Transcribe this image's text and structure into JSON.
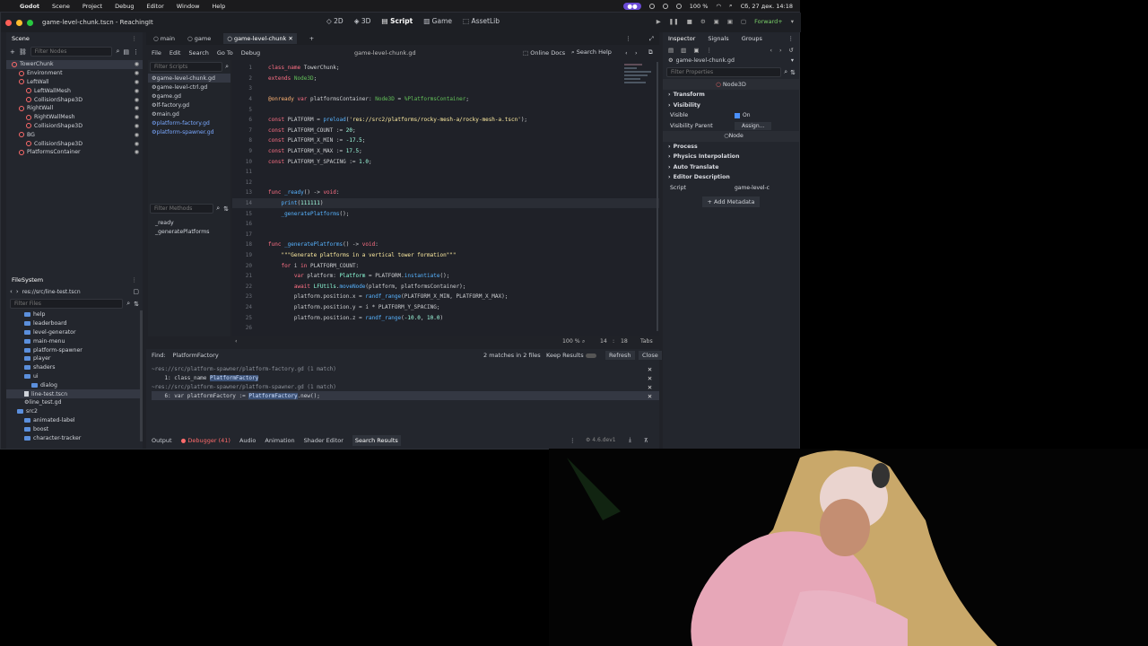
{
  "menubar": {
    "app": "Godot",
    "items": [
      "Scene",
      "Project",
      "Debug",
      "Editor",
      "Window",
      "Help"
    ],
    "battery": "100 %",
    "datetime": "Сб, 27 дек. 14:18"
  },
  "window": {
    "title": "game-level-chunk.tscn - ReachingIt",
    "workspaces": [
      "2D",
      "3D",
      "Script",
      "Game",
      "AssetLib"
    ],
    "active_workspace": "Script",
    "renderer": "Forward+"
  },
  "scene_dock": {
    "tabs": [
      "Scene",
      "Import"
    ],
    "filter_placeholder": "Filter Nodes",
    "nodes": [
      {
        "name": "TowerChunk",
        "depth": 0,
        "color": "#ff6b6b"
      },
      {
        "name": "Environment",
        "depth": 1,
        "color": "#ff6b6b"
      },
      {
        "name": "LeftWall",
        "depth": 1,
        "color": "#ff6b6b"
      },
      {
        "name": "LeftWallMesh",
        "depth": 2,
        "color": "#ff6b6b"
      },
      {
        "name": "CollisionShape3D",
        "depth": 2,
        "color": "#ff6b6b"
      },
      {
        "name": "RightWall",
        "depth": 1,
        "color": "#ff6b6b"
      },
      {
        "name": "RightWallMesh",
        "depth": 2,
        "color": "#ff6b6b"
      },
      {
        "name": "CollisionShape3D",
        "depth": 2,
        "color": "#ff6b6b"
      },
      {
        "name": "BG",
        "depth": 1,
        "color": "#ff6b6b"
      },
      {
        "name": "CollisionShape3D",
        "depth": 2,
        "color": "#ff6b6b"
      },
      {
        "name": "PlatformsContainer",
        "depth": 1,
        "color": "#ff6b6b"
      }
    ]
  },
  "filesystem": {
    "title": "FileSystem",
    "path": "res://src/line-test.tscn",
    "filter_placeholder": "Filter Files",
    "items": [
      {
        "name": "help",
        "depth": 2,
        "type": "folder"
      },
      {
        "name": "leaderboard",
        "depth": 2,
        "type": "folder"
      },
      {
        "name": "level-generator",
        "depth": 2,
        "type": "folder"
      },
      {
        "name": "main-menu",
        "depth": 2,
        "type": "folder"
      },
      {
        "name": "platform-spawner",
        "depth": 2,
        "type": "folder"
      },
      {
        "name": "player",
        "depth": 2,
        "type": "folder"
      },
      {
        "name": "shaders",
        "depth": 2,
        "type": "folder"
      },
      {
        "name": "ui",
        "depth": 2,
        "type": "folder"
      },
      {
        "name": "dialog",
        "depth": 3,
        "type": "folder"
      },
      {
        "name": "line-test.tscn",
        "depth": 2,
        "type": "scene",
        "selected": true
      },
      {
        "name": "line_test.gd",
        "depth": 2,
        "type": "script"
      },
      {
        "name": "src2",
        "depth": 1,
        "type": "folder"
      },
      {
        "name": "animated-label",
        "depth": 2,
        "type": "folder"
      },
      {
        "name": "boost",
        "depth": 2,
        "type": "folder"
      },
      {
        "name": "character-tracker",
        "depth": 2,
        "type": "folder"
      }
    ]
  },
  "editor_tabs": [
    "main",
    "game",
    "game-level-chunk"
  ],
  "active_tab": "game-level-chunk",
  "script_menu": [
    "File",
    "Edit",
    "Search",
    "Go To",
    "Debug"
  ],
  "current_file": "game-level-chunk.gd",
  "online_docs": "Online Docs",
  "search_help": "Search Help",
  "scripts_filter": "Filter Scripts",
  "scripts": [
    {
      "name": "game-level-chunk.gd",
      "selected": true,
      "blue": false
    },
    {
      "name": "game-level-ctrl.gd",
      "selected": false,
      "blue": false
    },
    {
      "name": "game.gd",
      "selected": false,
      "blue": false
    },
    {
      "name": "lf-factory.gd",
      "selected": false,
      "blue": false
    },
    {
      "name": "main.gd",
      "selected": false,
      "blue": false
    },
    {
      "name": "platform-factory.gd",
      "selected": false,
      "blue": true
    },
    {
      "name": "platform-spawner.gd",
      "selected": false,
      "blue": true
    }
  ],
  "methods_filter": "Filter Methods",
  "methods": [
    "_ready",
    "_generatePlatforms"
  ],
  "code": [
    {
      "n": "1",
      "parts": [
        [
          "kw",
          "class_name "
        ],
        [
          "tx",
          "TowerChunk;"
        ]
      ]
    },
    {
      "n": "2",
      "parts": [
        [
          "kw",
          "extends "
        ],
        [
          "node",
          "Node3D"
        ],
        [
          "tx",
          ";"
        ]
      ]
    },
    {
      "n": "3",
      "parts": []
    },
    {
      "n": "4",
      "parts": [
        [
          "ann",
          "@onready "
        ],
        [
          "kw",
          "var "
        ],
        [
          "tx",
          "platformsContainer: "
        ],
        [
          "node",
          "Node3D"
        ],
        [
          "tx",
          " = "
        ],
        [
          "node",
          "%PlatformsContainer"
        ],
        [
          "tx",
          ";"
        ]
      ]
    },
    {
      "n": "5",
      "parts": []
    },
    {
      "n": "6",
      "parts": [
        [
          "kw",
          "const "
        ],
        [
          "tx",
          "PLATFORM = "
        ],
        [
          "fn",
          "preload"
        ],
        [
          "tx",
          "("
        ],
        [
          "str",
          "'res://src2/platforms/rocky-mesh-a/rocky-mesh-a.tscn'"
        ],
        [
          "tx",
          ");"
        ]
      ]
    },
    {
      "n": "7",
      "parts": [
        [
          "kw",
          "const "
        ],
        [
          "tx",
          "PLATFORM_COUNT := "
        ],
        [
          "num",
          "20"
        ],
        [
          "tx",
          ";"
        ]
      ]
    },
    {
      "n": "8",
      "parts": [
        [
          "kw",
          "const "
        ],
        [
          "tx",
          "PLATFORM_X_MIN := "
        ],
        [
          "num",
          "-17.5"
        ],
        [
          "tx",
          ";"
        ]
      ]
    },
    {
      "n": "9",
      "parts": [
        [
          "kw",
          "const "
        ],
        [
          "tx",
          "PLATFORM_X_MAX := "
        ],
        [
          "num",
          "17.5"
        ],
        [
          "tx",
          ";"
        ]
      ]
    },
    {
      "n": "10",
      "parts": [
        [
          "kw",
          "const "
        ],
        [
          "tx",
          "PLATFORM_Y_SPACING := "
        ],
        [
          "num",
          "1.0"
        ],
        [
          "tx",
          ";"
        ]
      ]
    },
    {
      "n": "11",
      "parts": []
    },
    {
      "n": "12",
      "parts": []
    },
    {
      "n": "13",
      "parts": [
        [
          "kw",
          "func "
        ],
        [
          "fn",
          "_ready"
        ],
        [
          "tx",
          "() -> "
        ],
        [
          "kw",
          "void"
        ],
        [
          "tx",
          ":"
        ]
      ]
    },
    {
      "n": "14",
      "parts": [
        [
          "tx",
          "    "
        ],
        [
          "fn",
          "print"
        ],
        [
          "tx",
          "("
        ],
        [
          "num",
          "111111"
        ],
        [
          "tx",
          ")"
        ]
      ],
      "current": true
    },
    {
      "n": "15",
      "parts": [
        [
          "tx",
          "    "
        ],
        [
          "fn",
          "_generatePlatforms"
        ],
        [
          "tx",
          "();"
        ]
      ]
    },
    {
      "n": "16",
      "parts": []
    },
    {
      "n": "17",
      "parts": []
    },
    {
      "n": "18",
      "parts": [
        [
          "kw",
          "func "
        ],
        [
          "fn",
          "_generatePlatforms"
        ],
        [
          "tx",
          "() -> "
        ],
        [
          "kw",
          "void"
        ],
        [
          "tx",
          ":"
        ]
      ]
    },
    {
      "n": "19",
      "parts": [
        [
          "tx",
          "    "
        ],
        [
          "str",
          "\"\"\"Generate platforms in a vertical tower formation\"\"\""
        ]
      ]
    },
    {
      "n": "20",
      "parts": [
        [
          "tx",
          "    "
        ],
        [
          "kw",
          "for "
        ],
        [
          "tx",
          "i "
        ],
        [
          "kw",
          "in "
        ],
        [
          "tx",
          "PLATFORM_COUNT:"
        ]
      ]
    },
    {
      "n": "21",
      "parts": [
        [
          "tx",
          "        "
        ],
        [
          "kw",
          "var "
        ],
        [
          "tx",
          "platform: "
        ],
        [
          "ty",
          "Platform"
        ],
        [
          "tx",
          " = PLATFORM."
        ],
        [
          "fn",
          "instantiate"
        ],
        [
          "tx",
          "();"
        ]
      ]
    },
    {
      "n": "22",
      "parts": [
        [
          "tx",
          "        "
        ],
        [
          "kw",
          "await "
        ],
        [
          "ty",
          "LFUtils"
        ],
        [
          "tx",
          "."
        ],
        [
          "fn",
          "moveNode"
        ],
        [
          "tx",
          "(platform, platformsContainer);"
        ]
      ]
    },
    {
      "n": "23",
      "parts": [
        [
          "tx",
          "        platform.position.x = "
        ],
        [
          "fn",
          "randf_range"
        ],
        [
          "tx",
          "(PLATFORM_X_MIN, PLATFORM_X_MAX);"
        ]
      ]
    },
    {
      "n": "24",
      "parts": [
        [
          "tx",
          "        platform.position.y = i * PLATFORM_Y_SPACING;"
        ]
      ]
    },
    {
      "n": "25",
      "parts": [
        [
          "tx",
          "        platform.position.z = "
        ],
        [
          "fn",
          "randf_range"
        ],
        [
          "tx",
          "("
        ],
        [
          "num",
          "-10.0"
        ],
        [
          "tx",
          ", "
        ],
        [
          "num",
          "10.0"
        ],
        [
          "tx",
          ")"
        ]
      ]
    },
    {
      "n": "26",
      "parts": []
    }
  ],
  "status": {
    "zoom": "100 %",
    "line": "14",
    "col": "18",
    "indent": "Tabs"
  },
  "find": {
    "label": "Find:",
    "query": "PlatformFactory",
    "matches": "2 matches in 2 files",
    "keep_results": "Keep Results",
    "refresh": "Refresh",
    "close": "Close"
  },
  "results": [
    {
      "text": "~res://src/platform-spawner/platform-factory.gd (1 match)",
      "type": "file"
    },
    {
      "pre": "    1: class_name ",
      "hl": "PlatformFactory",
      "post": "",
      "type": "match"
    },
    {
      "text": "~res://src/platform-spawner/platform-spawner.gd (1 match)",
      "type": "file"
    },
    {
      "pre": "    6: var platformFactory := ",
      "hl": "PlatformFactory",
      "post": ".new();",
      "type": "match"
    }
  ],
  "bottom_tabs": [
    "Output",
    "Debugger (41)",
    "Audio",
    "Animation",
    "Shader Editor",
    "Search Results"
  ],
  "active_bottom_tab": "Search Results",
  "version": "4.6.dev1",
  "inspector": {
    "tabs": [
      "Inspector",
      "Signals",
      "Groups"
    ],
    "resource": "game-level-chunk.gd",
    "filter_placeholder": "Filter Properties",
    "class_header": "Node3D",
    "rows": [
      {
        "label": "Transform",
        "type": "section"
      },
      {
        "label": "Visibility",
        "type": "section"
      },
      {
        "label": "Visible",
        "type": "prop",
        "value": "On"
      },
      {
        "label": "Visibility Parent",
        "type": "prop",
        "value": "Assign..."
      },
      {
        "label": "Node",
        "type": "header"
      },
      {
        "label": "Process",
        "type": "section"
      },
      {
        "label": "Physics Interpolation",
        "type": "section"
      },
      {
        "label": "Auto Translate",
        "type": "section"
      },
      {
        "label": "Editor Description",
        "type": "section"
      },
      {
        "label": "Script",
        "type": "prop",
        "value": "game-level-c"
      }
    ],
    "add_metadata": "Add Metadata"
  }
}
